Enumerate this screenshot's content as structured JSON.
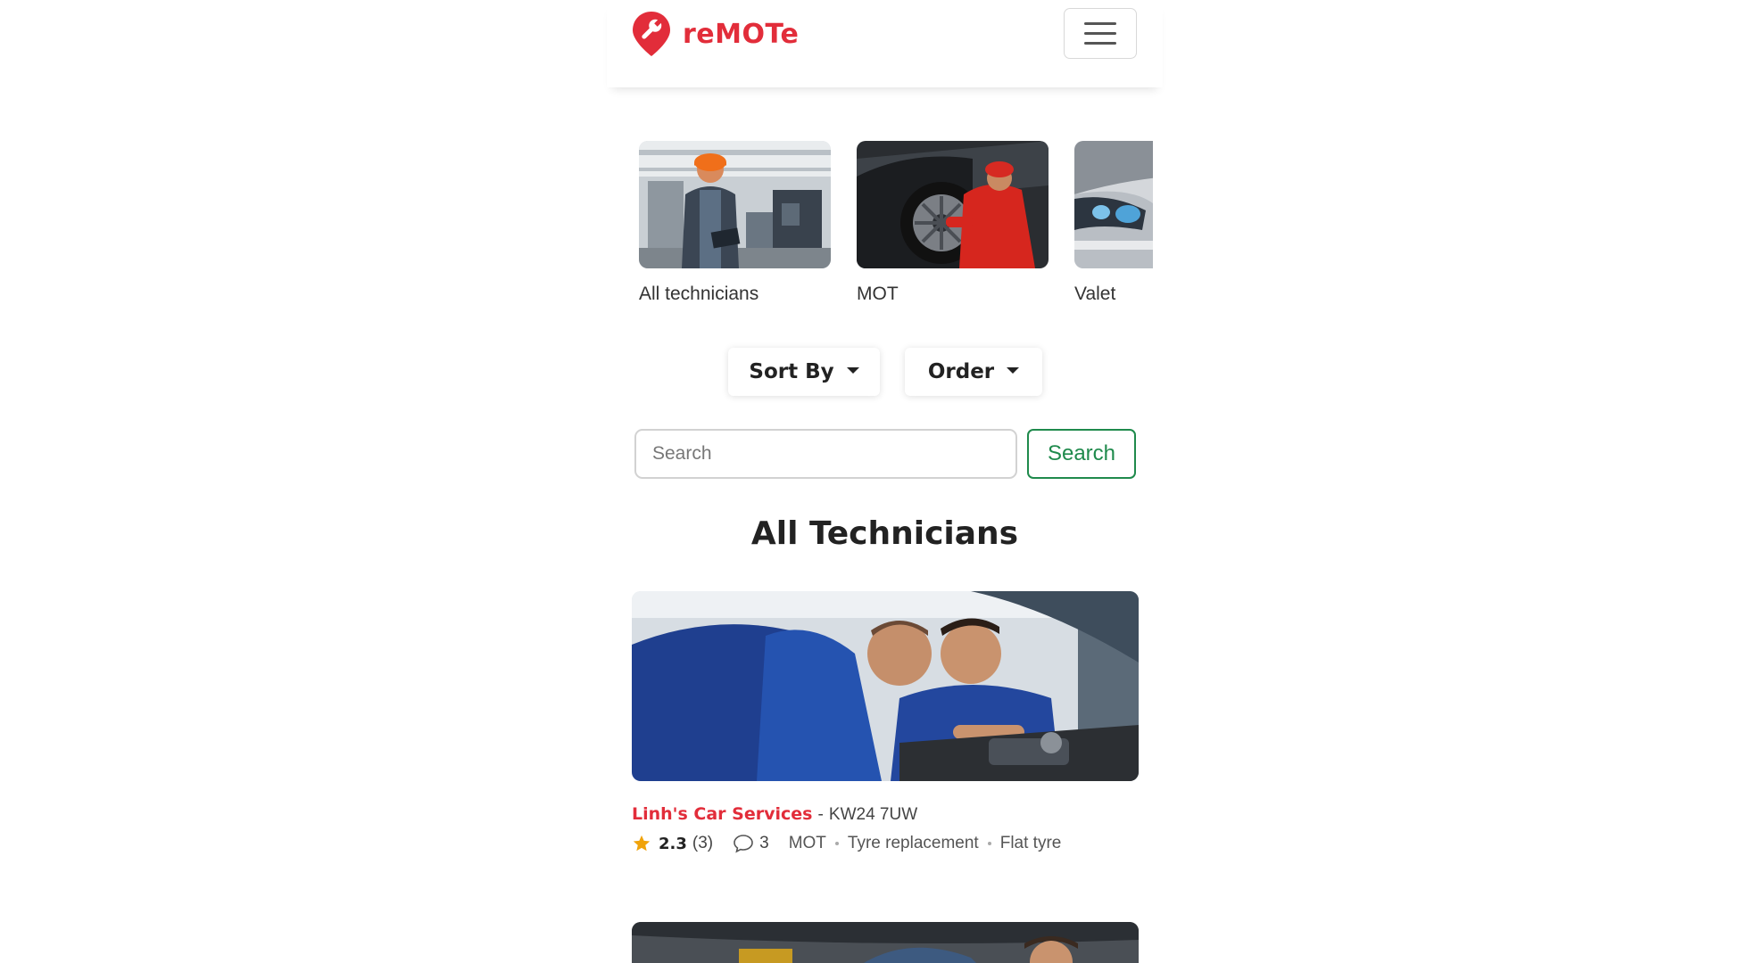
{
  "brand": {
    "name": "reMOTe",
    "color": "#e22d3a"
  },
  "nav": {
    "menu_icon": "hamburger-icon"
  },
  "categories": [
    {
      "label": "All technicians",
      "image": "mechanic-with-tablet-photo"
    },
    {
      "label": "MOT",
      "image": "mechanic-at-wheel-photo"
    },
    {
      "label": "Valet",
      "image": "car-headlight-photo"
    }
  ],
  "filters": {
    "sort_label": "Sort By",
    "order_label": "Order"
  },
  "search": {
    "placeholder": "Search",
    "button_label": "Search",
    "button_color": "#1f8a4c"
  },
  "section": {
    "title": "All Technicians"
  },
  "technicians": [
    {
      "name": "Linh's Car Services",
      "separator": "-",
      "postcode": "KW24 7UW",
      "rating": "2.3",
      "rating_count": "(3)",
      "comments": "3",
      "tags": [
        "MOT",
        "Tyre replacement",
        "Flat tyre"
      ],
      "image": "two-mechanics-engine-photo"
    }
  ]
}
